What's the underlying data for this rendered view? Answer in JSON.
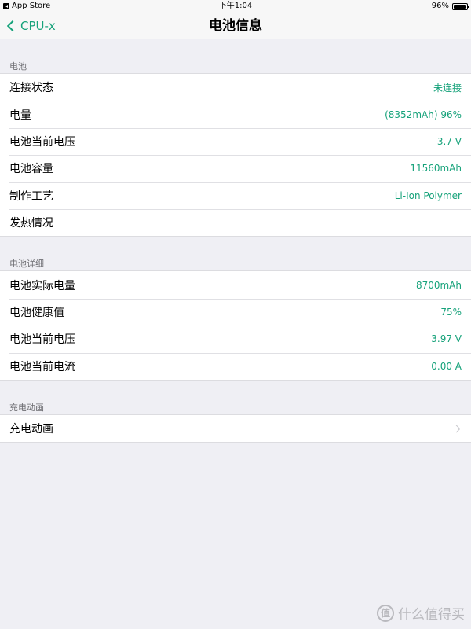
{
  "status_bar": {
    "back_app": "App Store",
    "time": "下午1:04",
    "battery_percent": "96%",
    "battery_level": 0.96
  },
  "nav": {
    "back_label": "CPU-x",
    "title": "电池信息"
  },
  "sections": [
    {
      "header": "电池",
      "rows": [
        {
          "label": "连接状态",
          "value": "未连接"
        },
        {
          "label": "电量",
          "value": "(8352mAh) 96%"
        },
        {
          "label": "电池当前电压",
          "value": "3.7 V"
        },
        {
          "label": "电池容量",
          "value": "11560mAh"
        },
        {
          "label": "制作工艺",
          "value": "Li-Ion Polymer"
        },
        {
          "label": "发热情况",
          "value": "-"
        }
      ]
    },
    {
      "header": "电池详细",
      "rows": [
        {
          "label": "电池实际电量",
          "value": "8700mAh"
        },
        {
          "label": "电池健康值",
          "value": "75%"
        },
        {
          "label": "电池当前电压",
          "value": "3.97 V"
        },
        {
          "label": "电池当前电流",
          "value": "0.00 A"
        }
      ]
    },
    {
      "header": "充电动画",
      "rows": [
        {
          "label": "充电动画",
          "value": ""
        }
      ]
    }
  ],
  "watermark": {
    "logo": "值",
    "text": "什么值得买"
  },
  "colors": {
    "accent": "#16a27a",
    "background": "#efeff4"
  }
}
